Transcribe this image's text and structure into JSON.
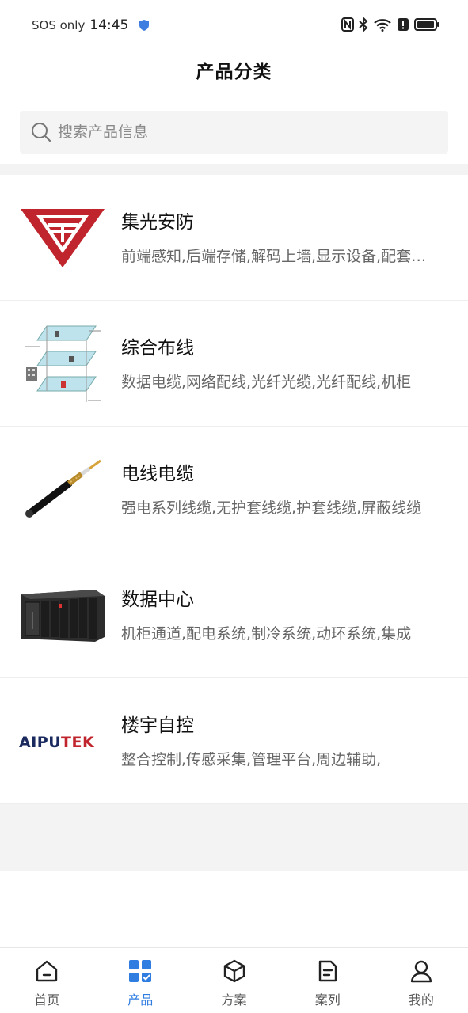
{
  "status": {
    "carrier": "SOS only",
    "time": "14:45"
  },
  "header": {
    "title": "产品分类"
  },
  "search": {
    "placeholder": "搜索产品信息"
  },
  "categories": [
    {
      "name": "集光安防",
      "desc": "前端感知,后端存储,解码上墙,显示设备,配套设备",
      "image": "logo-red-triangle"
    },
    {
      "name": "综合布线",
      "desc": "数据电缆,网络配线,光纤光缆,光纤配线,机柜",
      "image": "cabling-diagram"
    },
    {
      "name": "电线电缆",
      "desc": "强电系列线缆,无护套线缆,护套线缆,屏蔽线缆",
      "image": "cable"
    },
    {
      "name": "数据中心",
      "desc": "机柜通道,配电系统,制冷系统,动环系统,集成",
      "image": "datacenter-rack"
    },
    {
      "name": "楼宇自控",
      "desc": "整合控制,传感采集,管理平台,周边辅助,",
      "image": "aiputek-logo",
      "logo_text": "AIPUTEK"
    }
  ],
  "nav": [
    {
      "label": "首页",
      "icon": "home-icon",
      "active": false
    },
    {
      "label": "产品",
      "icon": "grid-icon",
      "active": true
    },
    {
      "label": "方案",
      "icon": "cube-icon",
      "active": false
    },
    {
      "label": "案列",
      "icon": "document-icon",
      "active": false
    },
    {
      "label": "我的",
      "icon": "user-icon",
      "active": false
    }
  ],
  "colors": {
    "accent": "#2f7de1",
    "logo_red": "#c0242c",
    "logo_navy": "#1b2a5e"
  }
}
